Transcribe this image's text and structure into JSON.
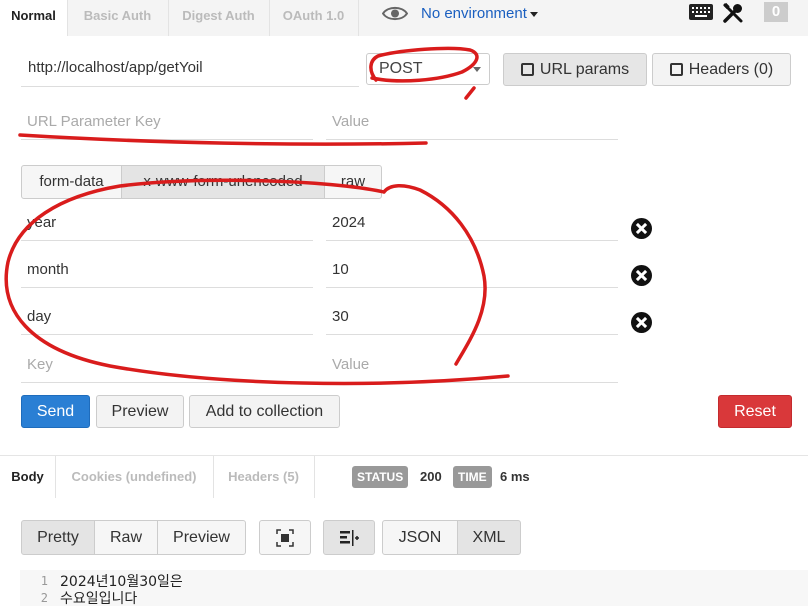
{
  "auth_tabs": [
    "Normal",
    "Basic Auth",
    "Digest Auth",
    "OAuth 1.0"
  ],
  "environment": "No environment",
  "counter": "0",
  "url": "http://localhost/app/getYoil",
  "method": "POST",
  "url_params_button": "URL params",
  "headers_button": "Headers (0)",
  "url_param": {
    "key_placeholder": "URL Parameter Key",
    "value_placeholder": "Value"
  },
  "body_modes": [
    "form-data",
    "x-www-form-urlencoded",
    "raw"
  ],
  "form_rows": [
    {
      "key": "year",
      "value": "2024"
    },
    {
      "key": "month",
      "value": "10"
    },
    {
      "key": "day",
      "value": "30"
    }
  ],
  "empty_row": {
    "key_placeholder": "Key",
    "value_placeholder": "Value"
  },
  "actions": {
    "send": "Send",
    "preview": "Preview",
    "add_to_collection": "Add to collection",
    "reset": "Reset"
  },
  "response_tabs": [
    "Body",
    "Cookies (undefined)",
    "Headers (5)"
  ],
  "status": {
    "label": "STATUS",
    "value": "200"
  },
  "time": {
    "label": "TIME",
    "value": "6 ms"
  },
  "view_modes": [
    "Pretty",
    "Raw",
    "Preview"
  ],
  "formats": [
    "JSON",
    "XML"
  ],
  "response_lines": [
    {
      "n": "1",
      "text": "2024년10월30일은"
    },
    {
      "n": "2",
      "text": "수요일입니다"
    }
  ],
  "annotation_color": "#d91c1c"
}
